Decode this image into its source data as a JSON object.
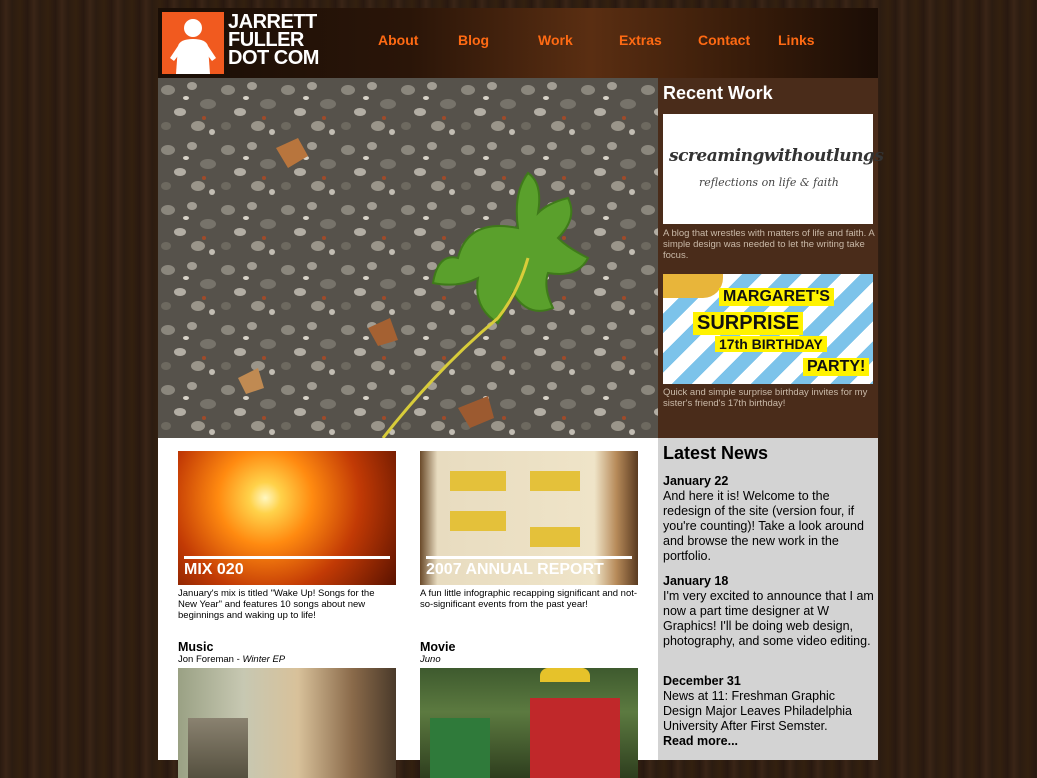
{
  "logo": {
    "line1": "JARRETT",
    "line2": "FULLER",
    "line3": "DOT COM",
    "brand_color": "#f15a1f"
  },
  "nav": [
    {
      "label": "About"
    },
    {
      "label": "Blog"
    },
    {
      "label": "Work"
    },
    {
      "label": "Extras"
    },
    {
      "label": "Contact"
    },
    {
      "label": "Links"
    }
  ],
  "recent_work": {
    "heading": "Recent Work",
    "items": [
      {
        "thumb_title": "screamingwithoutlungs",
        "thumb_subtitle": "reflections on life & faith",
        "description": "A blog that wrestles with matters of life and faith. A simple design was needed to let the writing take focus."
      },
      {
        "thumb_lines": [
          "MARGARET'S",
          "SURPRISE",
          "17th BIRTHDAY",
          "PARTY!"
        ],
        "description": "Quick and simple surprise birthday invites for my sister's friend's 17th birthday!"
      }
    ]
  },
  "features": [
    {
      "title": "MIX 020",
      "description": "January's mix is titled \"Wake Up! Songs for the New Year\" and features 10 songs about new beginnings and waking up to life!"
    },
    {
      "title": "2007 ANNUAL REPORT",
      "description": "A fun little infographic recapping significant and not-so-significant events from the past year!"
    }
  ],
  "media": [
    {
      "heading": "Music",
      "artist": "Jon Foreman",
      "separator": " - ",
      "work": "Winter EP"
    },
    {
      "heading": "Movie",
      "artist": "",
      "separator": "",
      "work": "Juno"
    }
  ],
  "latest_news": {
    "heading": "Latest News",
    "items": [
      {
        "date": "January 22",
        "text": "And here it is! Welcome to the redesign of the site (version four, if you're counting)! Take a look around and browse the new work in the portfolio."
      },
      {
        "date": "January 18",
        "text": "I'm very excited to announce that I am now a part time designer at W Graphics! I'll be doing web design, photography, and some video editing."
      },
      {
        "date": "December 31",
        "text": "News at 11: Freshman Graphic Design Major Leaves Philadelphia University After First Semster."
      }
    ],
    "read_more": "Read more..."
  },
  "colors": {
    "nav_link": "#ff6a13",
    "recent_bg": "#4a2c1a",
    "news_bg": "#d3d3d3"
  }
}
